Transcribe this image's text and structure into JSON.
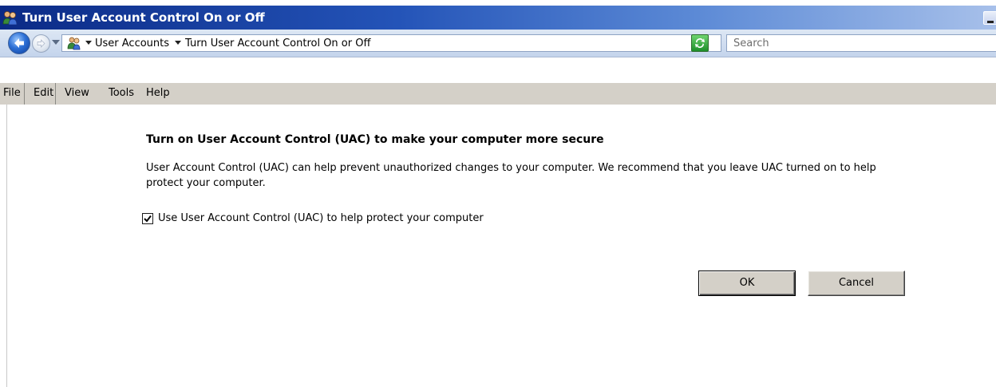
{
  "window": {
    "title": "Turn User Account Control On or Off"
  },
  "address_bar": {
    "crumbs": [
      "User Accounts",
      "Turn User Account Control On or Off"
    ],
    "search_placeholder": "Search"
  },
  "menu": {
    "items": [
      "File",
      "Edit",
      "View",
      "Tools",
      "Help"
    ]
  },
  "content": {
    "heading": "Turn on User Account Control (UAC) to make your computer more secure",
    "description": "User Account Control (UAC) can help prevent unauthorized changes to your computer.  We recommend that you leave UAC turned on to help protect your computer.",
    "checkbox_label": "Use User Account Control (UAC) to help protect your computer",
    "checkbox_checked": true,
    "ok_label": "OK",
    "cancel_label": "Cancel"
  },
  "colors": {
    "title_bar_start": "#0b2a86",
    "title_bar_end": "#a7c0ea",
    "menu_bar": "#d4d0c8"
  }
}
